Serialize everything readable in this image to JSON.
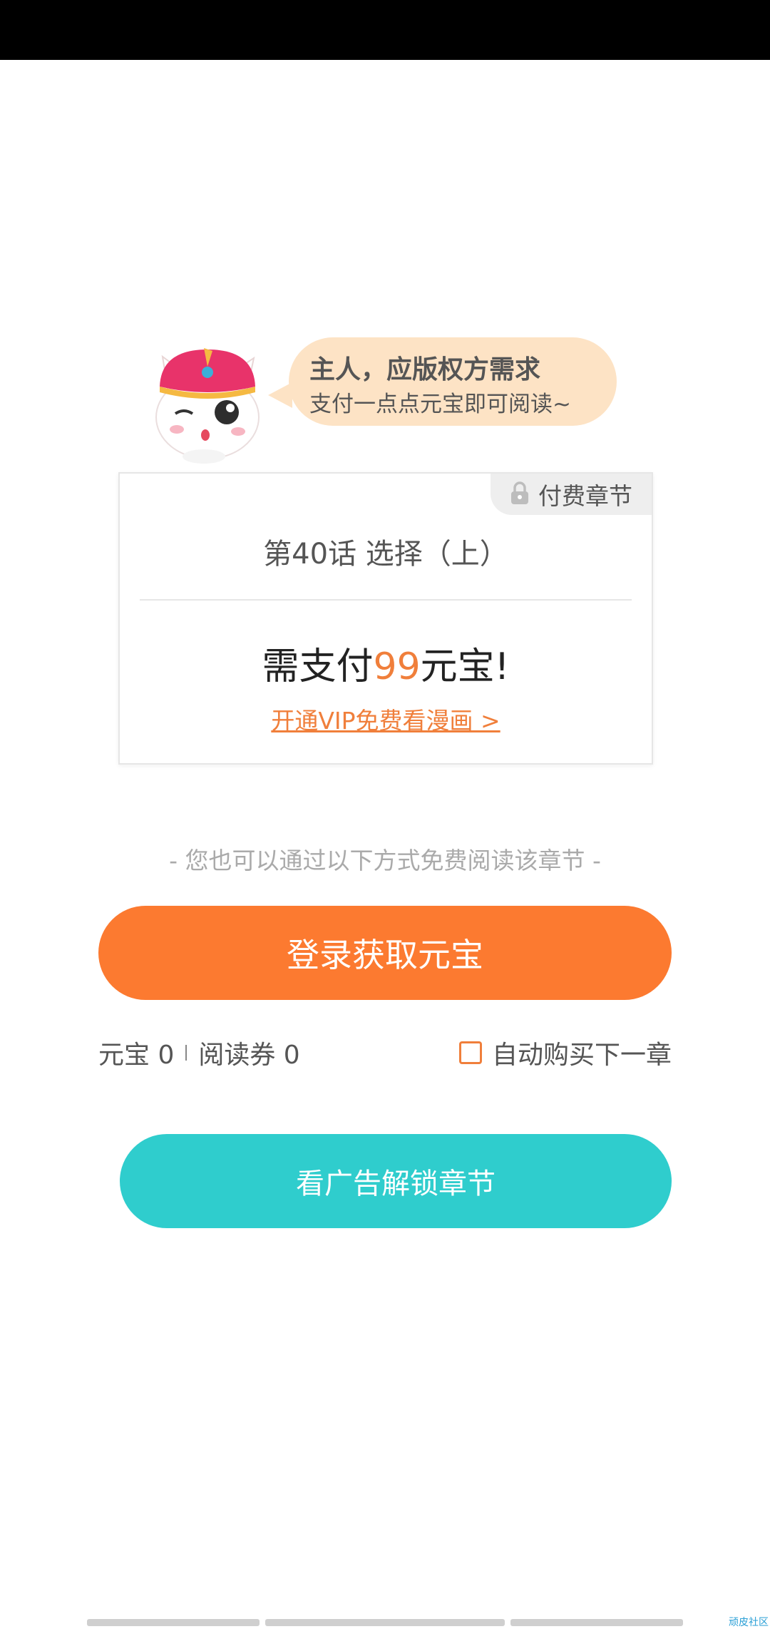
{
  "mascot": {
    "icon": "cat-mascot-icon",
    "bubble_line1": "主人，应版权方需求",
    "bubble_line2": "支付一点点元宝即可阅读~"
  },
  "card": {
    "badge_icon": "lock-icon",
    "badge_label": "付费章节",
    "chapter_title": "第40话 选择（上）",
    "price_prefix": "需支付",
    "price_amount": "99",
    "price_suffix": "元宝!",
    "vip_link": "开通VIP免费看漫画 >"
  },
  "free_hint": "- 您也可以通过以下方式免费阅读该章节 -",
  "login_button": "登录获取元宝",
  "balance": {
    "yuanbao": "元宝 0",
    "tickets": "阅读券 0"
  },
  "auto_buy": {
    "label": "自动购买下一章",
    "checked": false
  },
  "ad_button": "看广告解锁章节",
  "watermark": "顽皮社区",
  "colors": {
    "accent_orange": "#fc7a30",
    "accent_teal": "#2fcdcd",
    "bubble": "#fde3c5"
  }
}
